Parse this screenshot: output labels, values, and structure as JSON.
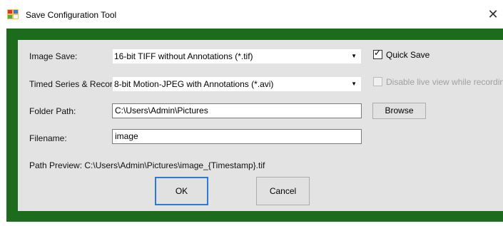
{
  "window": {
    "title": "Save Configuration Tool",
    "close_glyph": "✕",
    "icon": "app-icon",
    "frame_color": "#1d6b1d",
    "panel_color": "#e3e3e3",
    "accent": "#2d7ad6"
  },
  "form": {
    "image_save": {
      "label": "Image Save:",
      "value": "16-bit TIFF without Annotations (*.tif)"
    },
    "timed_series": {
      "label": "Timed Series & Record:",
      "value": "8-bit Motion-JPEG with Annotations (*.avi)"
    },
    "folder_path": {
      "label": "Folder Path:",
      "value": "C:\\Users\\Admin\\Pictures"
    },
    "filename": {
      "label": "Filename:",
      "value": "image"
    },
    "path_preview": "Path Preview: C:\\Users\\Admin\\Pictures\\image_{Timestamp}.tif"
  },
  "options": {
    "quick_save": {
      "label": "Quick Save",
      "checked": true,
      "check_glyph": "✓"
    },
    "disable_live_view": {
      "label": "Disable live view while recording",
      "checked": false,
      "enabled": false
    }
  },
  "buttons": {
    "browse": "Browse",
    "ok": "OK",
    "cancel": "Cancel"
  }
}
